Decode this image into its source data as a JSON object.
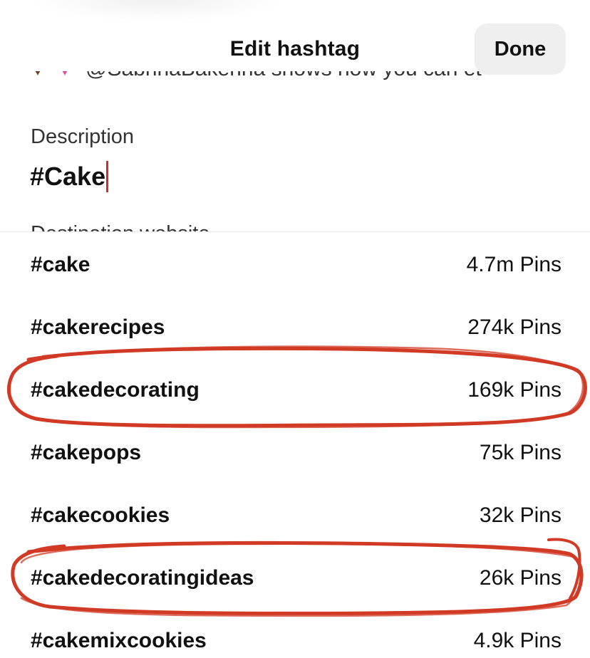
{
  "header": {
    "title": "Edit hashtag",
    "done_label": "Done"
  },
  "previous_content": {
    "text": "@SabrinaBakerina shows how you can et",
    "icons": [
      "brown-heart-icon",
      "pink-heart-icon"
    ]
  },
  "description": {
    "label": "Description",
    "value": "#Cake"
  },
  "destination": {
    "label": "Destination website"
  },
  "suggestions": [
    {
      "tag": "#cake",
      "count": "4.7m Pins",
      "circled": false
    },
    {
      "tag": "#cakerecipes",
      "count": "274k Pins",
      "circled": false
    },
    {
      "tag": "#cakedecorating",
      "count": "169k Pins",
      "circled": true
    },
    {
      "tag": "#cakepops",
      "count": "75k Pins",
      "circled": false
    },
    {
      "tag": "#cakecookies",
      "count": "32k Pins",
      "circled": false
    },
    {
      "tag": "#cakedecoratingideas",
      "count": "26k Pins",
      "circled": true
    },
    {
      "tag": "#cakemixcookies",
      "count": "4.9k Pins",
      "circled": false
    }
  ],
  "colors": {
    "annotation": "#d13a24",
    "caret": "#d42a2a",
    "done_bg": "#efefef"
  }
}
